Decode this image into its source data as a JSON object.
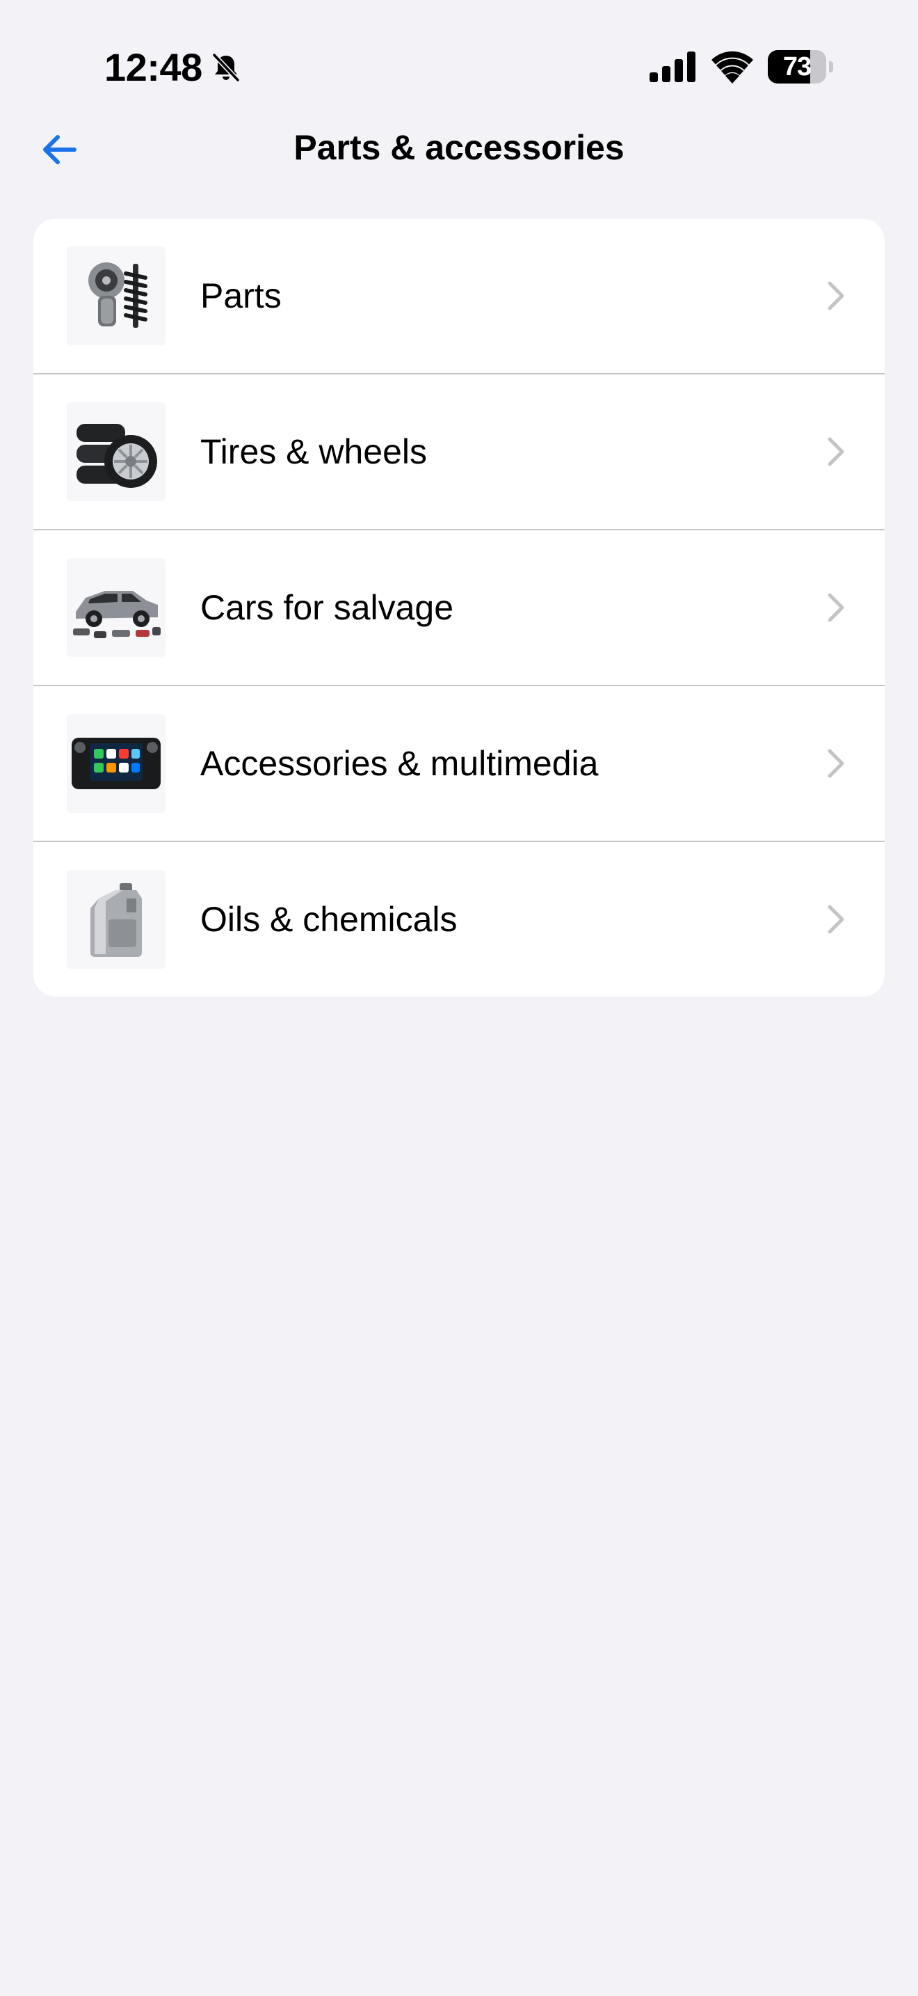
{
  "status_bar": {
    "time": "12:48",
    "battery_percent": "73",
    "battery_level": 0.73,
    "icons": [
      "bell-slash-icon",
      "cellular-signal-icon",
      "wifi-icon",
      "battery-icon"
    ]
  },
  "nav": {
    "back_icon": "arrow-left-icon",
    "title": "Parts & accessories"
  },
  "colors": {
    "accent": "#1a73e8",
    "background": "#f2f2f7",
    "card": "#ffffff",
    "separator": "#c6c6c8",
    "chevron": "#c4c4c7"
  },
  "categories": [
    {
      "label": "Parts",
      "icon": "auto-parts-icon"
    },
    {
      "label": "Tires & wheels",
      "icon": "tires-wheels-icon"
    },
    {
      "label": "Cars for salvage",
      "icon": "salvage-car-icon"
    },
    {
      "label": "Accessories & multimedia",
      "icon": "car-multimedia-icon"
    },
    {
      "label": "Oils & chemicals",
      "icon": "oil-canister-icon"
    }
  ]
}
